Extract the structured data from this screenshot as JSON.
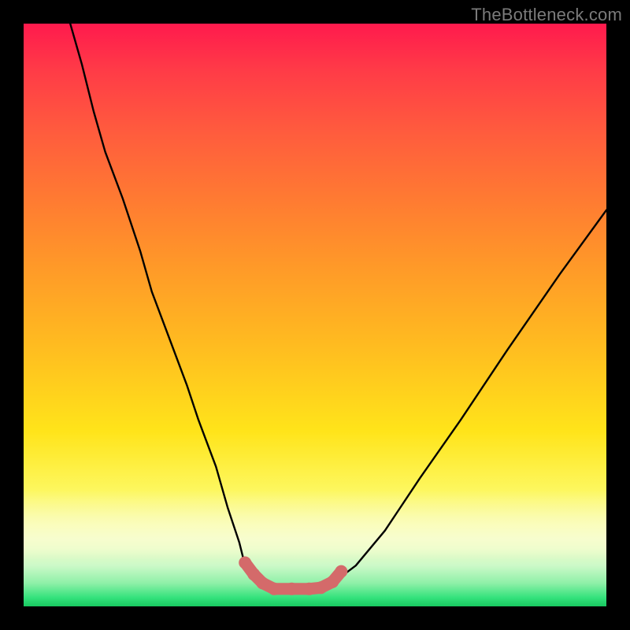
{
  "watermark": "TheBottleneck.com",
  "colors": {
    "background": "#000000",
    "gradient_top": "#ff1a4d",
    "gradient_mid": "#ffe41a",
    "gradient_bottom": "#18c860",
    "curve": "#000000",
    "marker": "#d46a6a"
  },
  "chart_data": {
    "type": "line",
    "title": "",
    "xlabel": "",
    "ylabel": "",
    "xlim": [
      0,
      100
    ],
    "ylim": [
      0,
      100
    ],
    "grid": false,
    "legend": false,
    "note": "Units are percent of plot area; x left→right, y bottom→top. Curve is a V-shaped bottleneck curve with a flat minimum near y≈3. Markers trace the flat trough.",
    "series": [
      {
        "name": "bottleneck-curve",
        "x": [
          8,
          10,
          12,
          14,
          17,
          20,
          22,
          25,
          28,
          30,
          33,
          35,
          37,
          38,
          40,
          42,
          44,
          47,
          50,
          53,
          57,
          62,
          68,
          75,
          83,
          92,
          100
        ],
        "y": [
          100,
          93,
          85,
          78,
          70,
          61,
          54,
          46,
          38,
          32,
          24,
          17,
          11,
          7,
          4,
          3,
          3,
          3,
          3,
          4,
          7,
          13,
          22,
          32,
          44,
          57,
          68
        ]
      }
    ],
    "markers": {
      "name": "trough-dots",
      "shape": "circle",
      "radius_px": 8,
      "x": [
        38,
        39.5,
        41,
        43,
        46,
        49,
        51,
        53,
        54.5
      ],
      "y": [
        7.5,
        5.5,
        4,
        3,
        3,
        3,
        3.2,
        4.2,
        6
      ]
    }
  }
}
